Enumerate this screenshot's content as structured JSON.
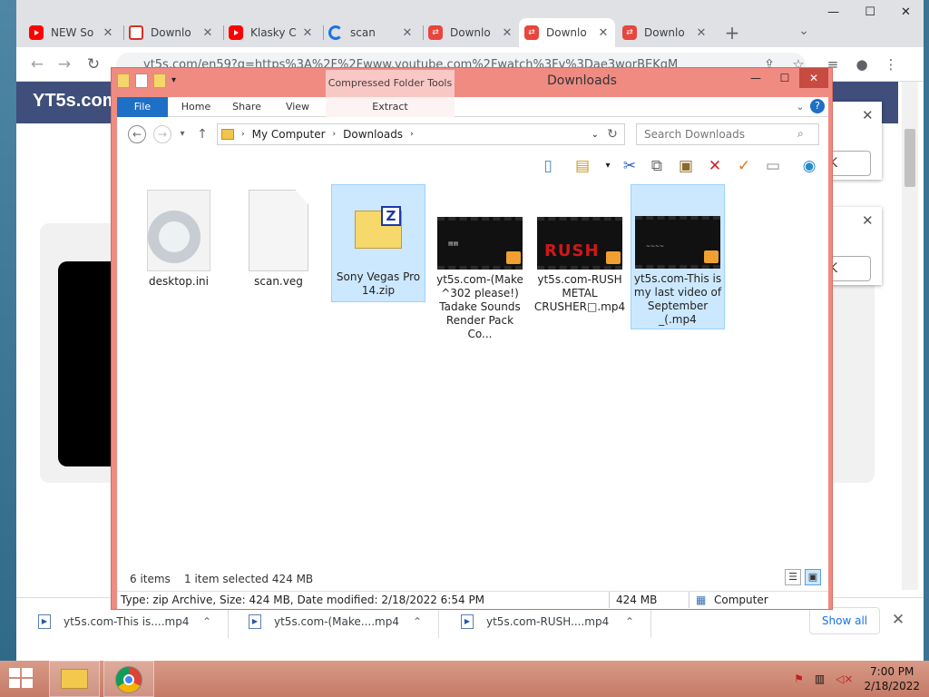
{
  "chrome": {
    "tabs": [
      {
        "label": "NEW So",
        "favicon": "youtube-icon"
      },
      {
        "label": "Downlo",
        "favicon": "gmail-icon"
      },
      {
        "label": "Klasky C",
        "favicon": "youtube-icon"
      },
      {
        "label": "scan",
        "favicon": "scan-icon"
      },
      {
        "label": "Downlo",
        "favicon": "download-icon"
      },
      {
        "label": "Downlo",
        "favicon": "download-icon"
      },
      {
        "label": "Downlo",
        "favicon": "download-icon"
      }
    ],
    "active_tab": 5,
    "url": "yt5s.com/en59?q=https%3A%2F%2Fwww.youtube.com%2Fwatch%3Fv%3Dae3worBEKgM"
  },
  "page": {
    "logo": "YT5s.com",
    "ok_label": "OK"
  },
  "downloads_bar": {
    "items": [
      "yt5s.com-This is....mp4",
      "yt5s.com-(Make....mp4",
      "yt5s.com-RUSH....mp4"
    ],
    "show_all": "Show all"
  },
  "explorer": {
    "title": "Downloads",
    "context_tab": "Compressed Folder Tools",
    "ribbon_tabs": [
      "File",
      "Home",
      "Share",
      "View",
      "Extract"
    ],
    "breadcrumb": [
      "My Computer",
      "Downloads"
    ],
    "search_placeholder": "Search Downloads",
    "files": [
      {
        "name": "desktop.ini",
        "icon": "settings-file-icon",
        "selected": false
      },
      {
        "name": "scan.veg",
        "icon": "blank-file-icon",
        "selected": false
      },
      {
        "name": "Sony Vegas Pro 14.zip",
        "icon": "zip-folder-icon",
        "selected": true
      },
      {
        "name": "yt5s.com-(Make ^302 please!) Tadake Sounds Render Pack Co...",
        "icon": "video-file-icon",
        "selected": false
      },
      {
        "name": "yt5s.com-RUSH METAL CRUSHER□.mp4",
        "icon": "video-file-icon",
        "selected": false
      },
      {
        "name": "yt5s.com-This is my last video of September _(.mp4",
        "icon": "video-file-icon",
        "selected": true
      }
    ],
    "item_count": "6 items",
    "selection": "1 item selected  424 MB",
    "details": "Type: zip Archive, Size: 424 MB, Date modified: 2/18/2022 6:54 PM",
    "details_size": "424 MB",
    "details_location": "Computer"
  },
  "taskbar": {
    "time": "7:00 PM",
    "date": "2/18/2022"
  }
}
